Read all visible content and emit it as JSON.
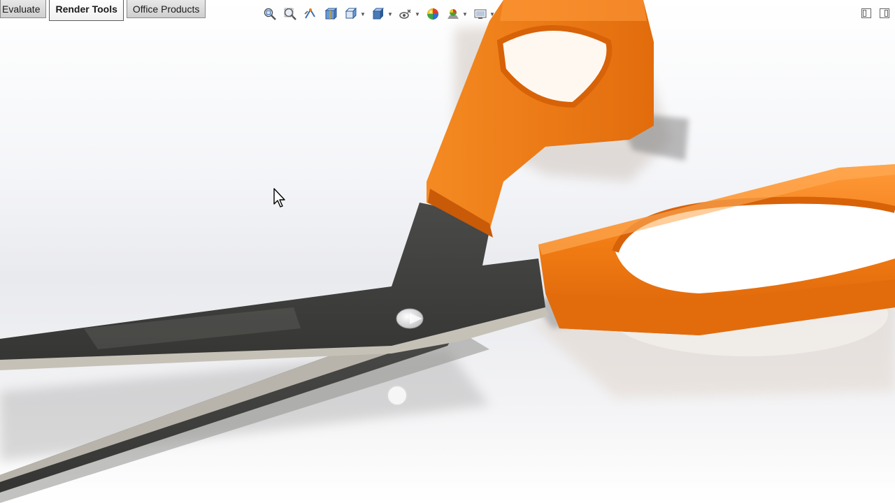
{
  "command_manager": {
    "tabs": [
      {
        "label": "Evaluate",
        "active": false
      },
      {
        "label": "Render Tools",
        "active": true
      },
      {
        "label": "Office Products",
        "active": false
      }
    ]
  },
  "heads_up_toolbar": {
    "buttons": [
      {
        "icon": "zoom-to-fit-icon"
      },
      {
        "icon": "zoom-to-area-icon"
      },
      {
        "icon": "previous-view-icon"
      },
      {
        "icon": "section-view-icon"
      },
      {
        "icon": "view-orientation-icon",
        "dropdown": true
      },
      {
        "icon": "display-style-icon",
        "dropdown": true
      },
      {
        "icon": "hide-show-items-icon",
        "dropdown": true
      },
      {
        "icon": "edit-appearance-icon"
      },
      {
        "icon": "apply-scene-icon",
        "dropdown": true
      },
      {
        "icon": "view-settings-icon",
        "dropdown": true
      }
    ]
  },
  "window_controls": [
    {
      "icon": "tile-horizontal-icon"
    },
    {
      "icon": "tile-vertical-icon"
    }
  ],
  "scene": {
    "model": "scissors",
    "colors": {
      "handle": "#f07a12",
      "handle_shadow": "#c85a08",
      "blade": "#3f3f3d",
      "blade_edge": "#b8b4ab",
      "pivot": "#e8e8ea"
    }
  }
}
